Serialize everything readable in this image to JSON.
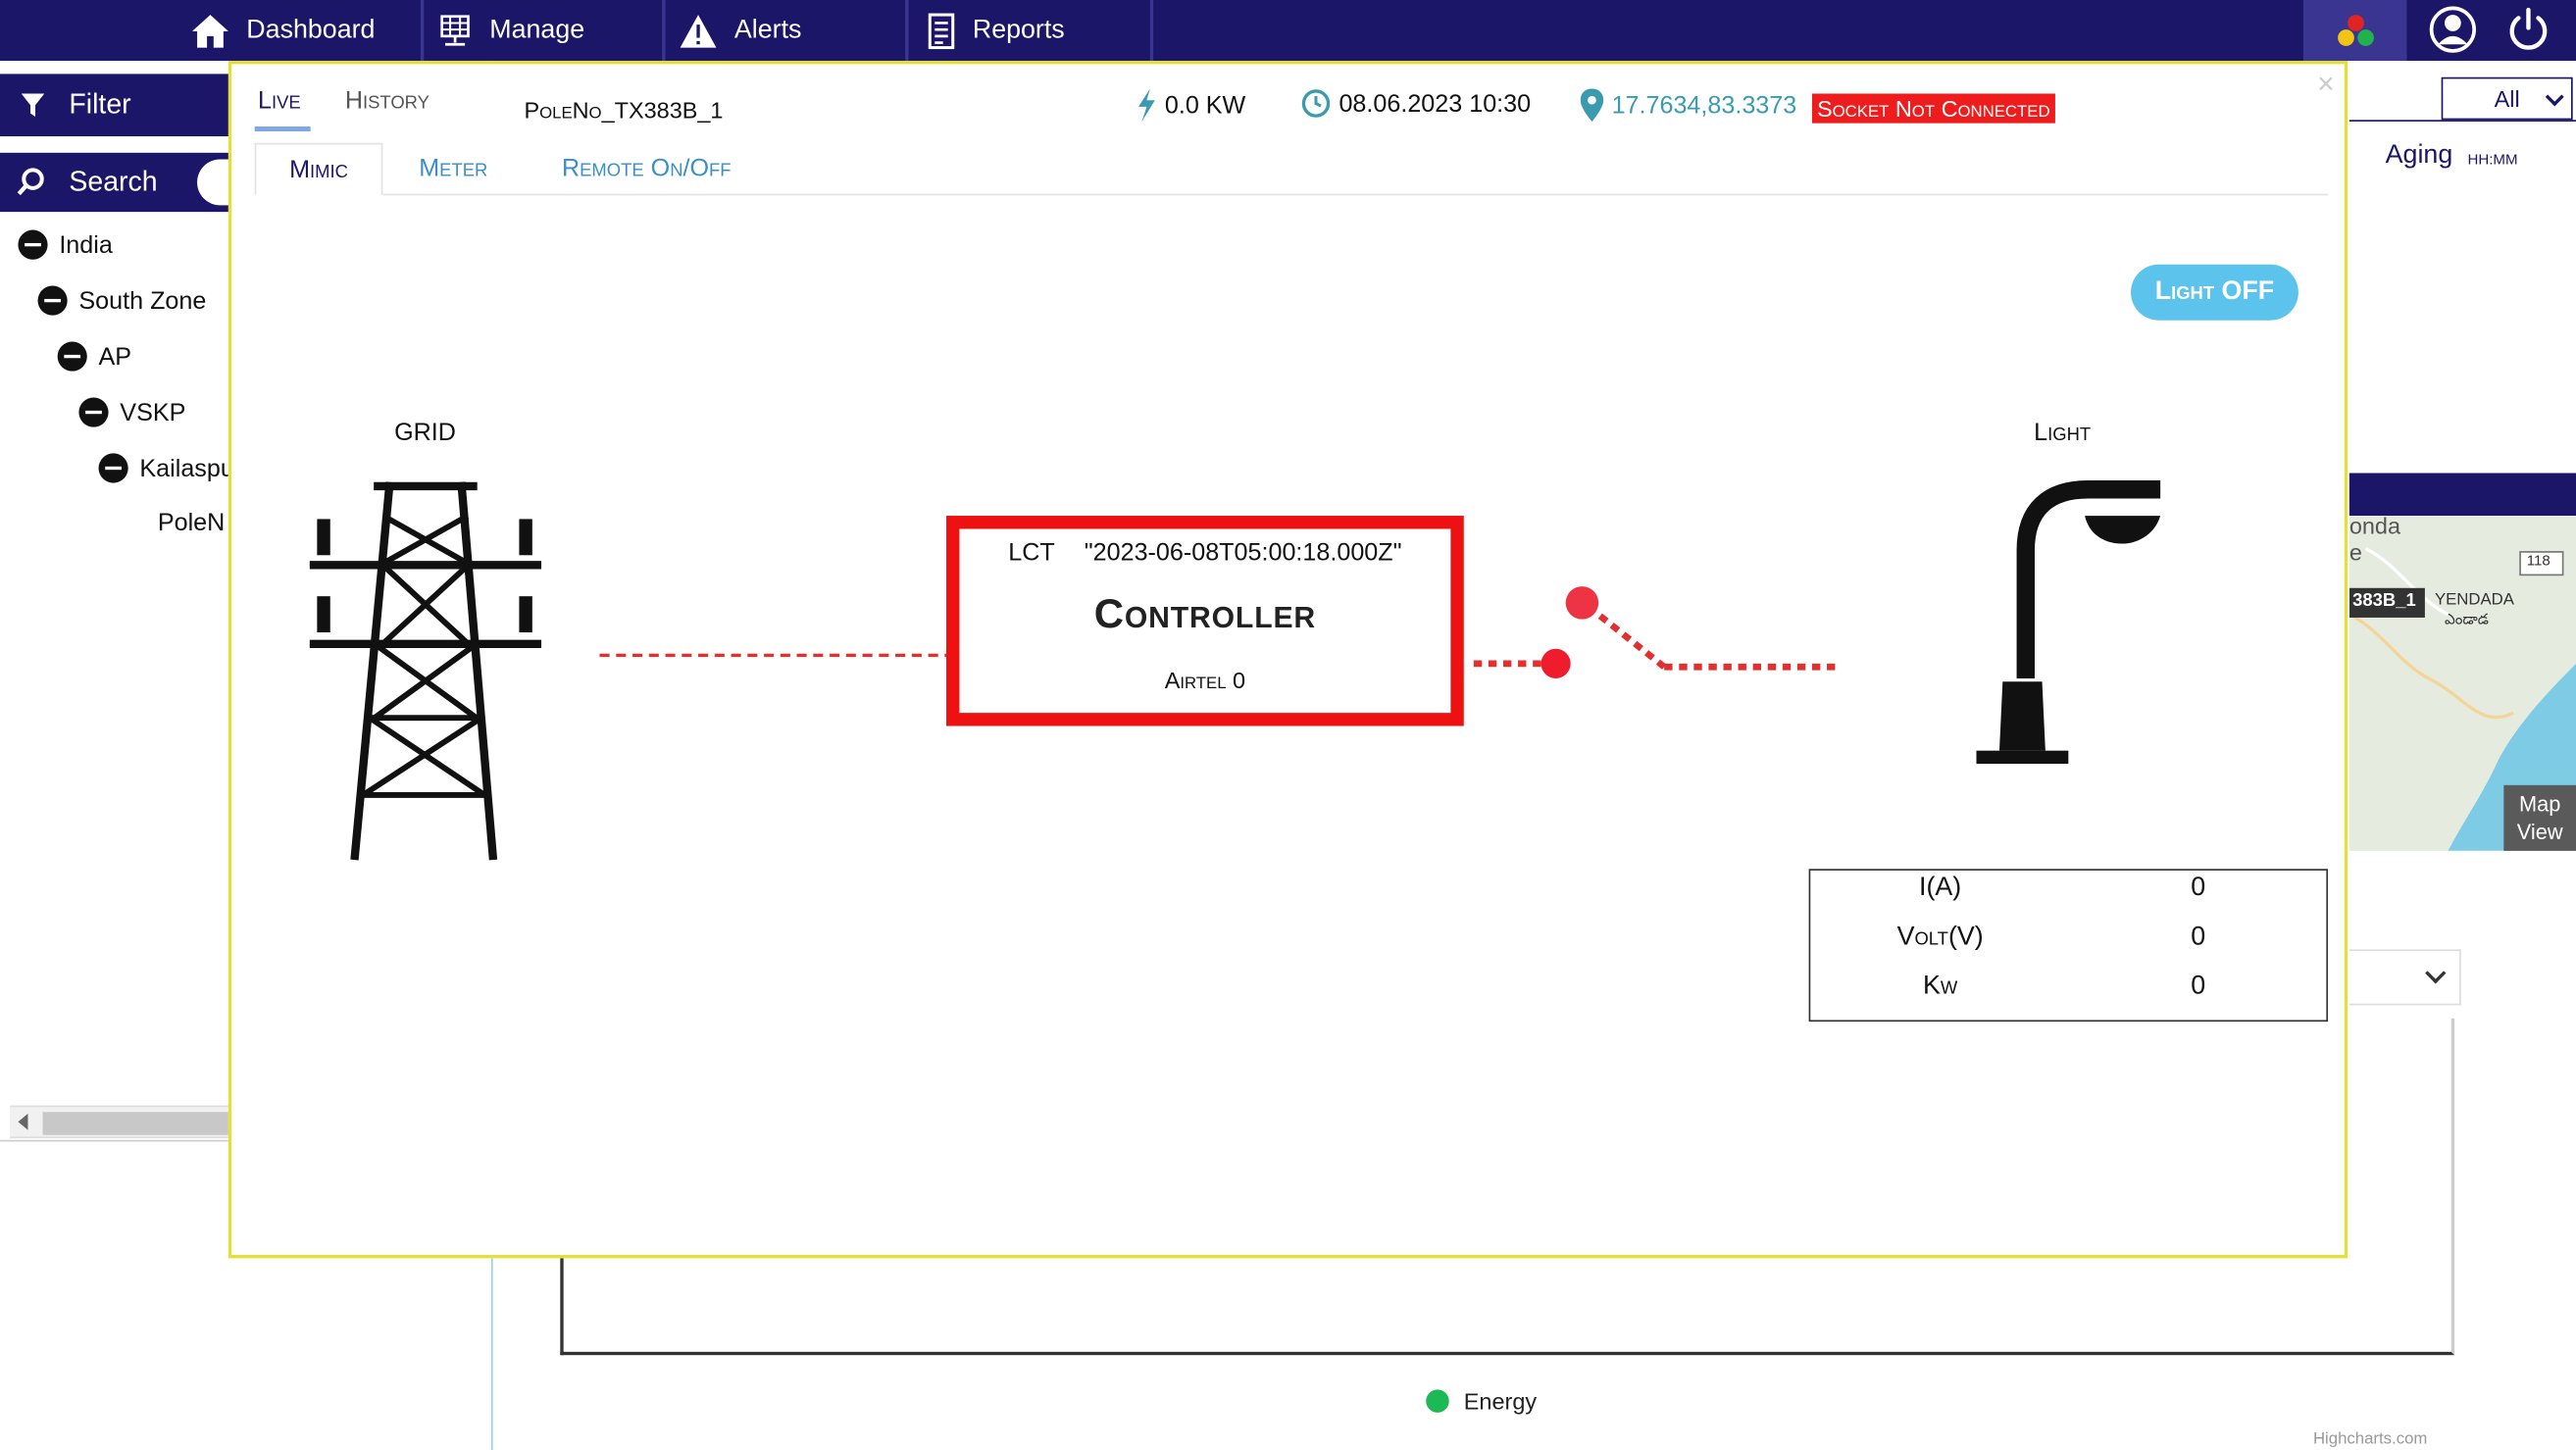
{
  "nav": {
    "items": [
      {
        "label": "Dashboard",
        "icon": "home-icon"
      },
      {
        "label": "Manage",
        "icon": "manage-icon"
      },
      {
        "label": "Alerts",
        "icon": "alert-icon"
      },
      {
        "label": "Reports",
        "icon": "reports-icon"
      }
    ]
  },
  "sidebar": {
    "filter_label": "Filter",
    "search_label": "Search",
    "tree": [
      {
        "label": "India"
      },
      {
        "label": "South Zone"
      },
      {
        "label": "AP"
      },
      {
        "label": "VSKP"
      },
      {
        "label": "Kailaspu"
      },
      {
        "label": "PoleN"
      }
    ]
  },
  "background": {
    "all_select": "All",
    "aging_label": "Aging",
    "aging_unit": "HH:MM",
    "map_view_label_1": "Map",
    "map_view_label_2": "View",
    "map_texts": {
      "place1": "onda",
      "place2": "e",
      "pole_tag": "383B_1",
      "yendada": "YENDADA",
      "yendada_te": "ఎండాడ",
      "route": "118"
    },
    "legend_label": "Energy",
    "credits": "Highcharts.com"
  },
  "modal": {
    "close_glyph": "×",
    "tab_live": "Live",
    "tab_history": "History",
    "pole_no": "PoleNo_TX383B_1",
    "kw": "0.0 KW",
    "datetime": "08.06.2023 10:30",
    "location": "17.7634,83.3373",
    "socket_status": "Socket Not Connected",
    "subtabs": {
      "mimic": "Mimic",
      "meter": "Meter",
      "remote": "Remote On/Off"
    },
    "light_button": "Light OFF",
    "grid_label": "GRID",
    "light_label": "Light",
    "controller": {
      "lct_label": "LCT",
      "lct_value": "\"2023-06-08T05:00:18.000Z\"",
      "title": "Controller",
      "airtel": "Airtel 0"
    },
    "readings": [
      {
        "label": "I(A)",
        "value": "0"
      },
      {
        "label": "Volt(V)",
        "value": "0"
      },
      {
        "label": "Kw",
        "value": "0"
      }
    ]
  },
  "colors": {
    "nav_bg": "#1c1668",
    "modal_border": "#e4df3a",
    "controller_border": "#ee1111",
    "socket_badge": "#ee1c1c",
    "light_button": "#5cc3ec"
  }
}
